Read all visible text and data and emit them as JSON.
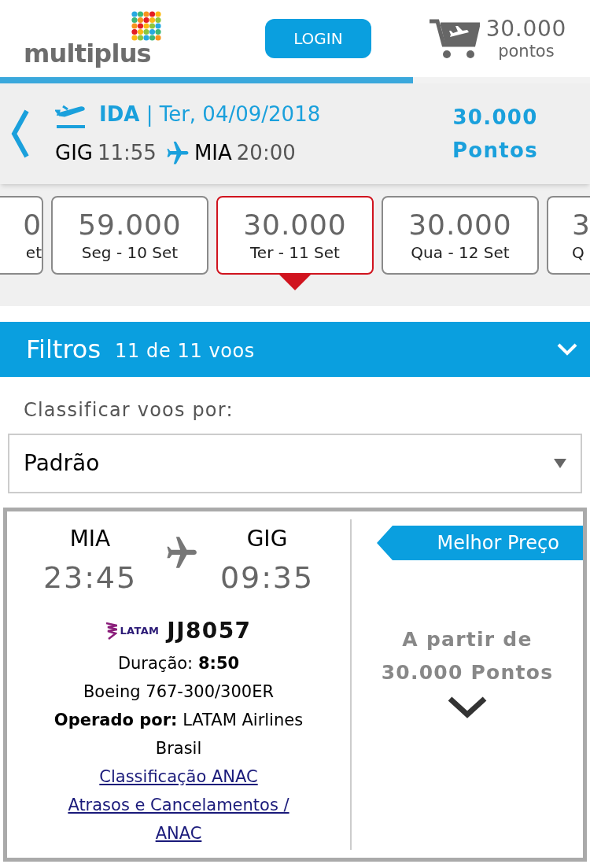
{
  "header": {
    "logo": "multiplus",
    "login_button": "LOGIN",
    "cart": {
      "points": "30.000",
      "unit": "pontos"
    }
  },
  "progress": {
    "level": 0.7
  },
  "flight_summary": {
    "direction_date": "**IDA** | Ter, 04/09/2018",
    "origin": "GIG",
    "departure": "11:55",
    "destination": "MIA",
    "arrival": "20:00",
    "points": "30.000",
    "points_unit": "Pontos"
  },
  "date_options": [
    {
      "points": "0",
      "day": "et",
      "selected": false,
      "kind": "cut-left"
    },
    {
      "points": "59.000",
      "day": "Seg - 10 Set",
      "selected": false,
      "kind": "full"
    },
    {
      "points": "30.000",
      "day": "Ter - 11 Set",
      "selected": true,
      "kind": "full"
    },
    {
      "points": "30.000",
      "day": "Qua - 12 Set",
      "selected": false,
      "kind": "full"
    },
    {
      "points": "3",
      "day": "Q",
      "selected": false,
      "kind": "cut-right"
    }
  ],
  "filters": {
    "title": "Filtros",
    "count": "11 de 11 voos"
  },
  "sort": {
    "label": "Classificar voos por:",
    "value": "Padrão"
  },
  "flight": {
    "origin": "MIA",
    "departure": "23:45",
    "destination": "GIG",
    "arrival": "09:35",
    "airline_logo": "LATAM",
    "flight_number": "JJ8057",
    "duration": "Duração: **8:50**",
    "aircraft": "Boeing 767-300/300ER",
    "operated_by": "**Operado por:** LATAM Airlines Brasil",
    "links": [
      "Classificação ANAC",
      "Atrasos e Cancelamentos / ANAC"
    ],
    "badge": "Melhor Preço",
    "price_label": "A partir de",
    "price": "30.000 Pontos"
  }
}
